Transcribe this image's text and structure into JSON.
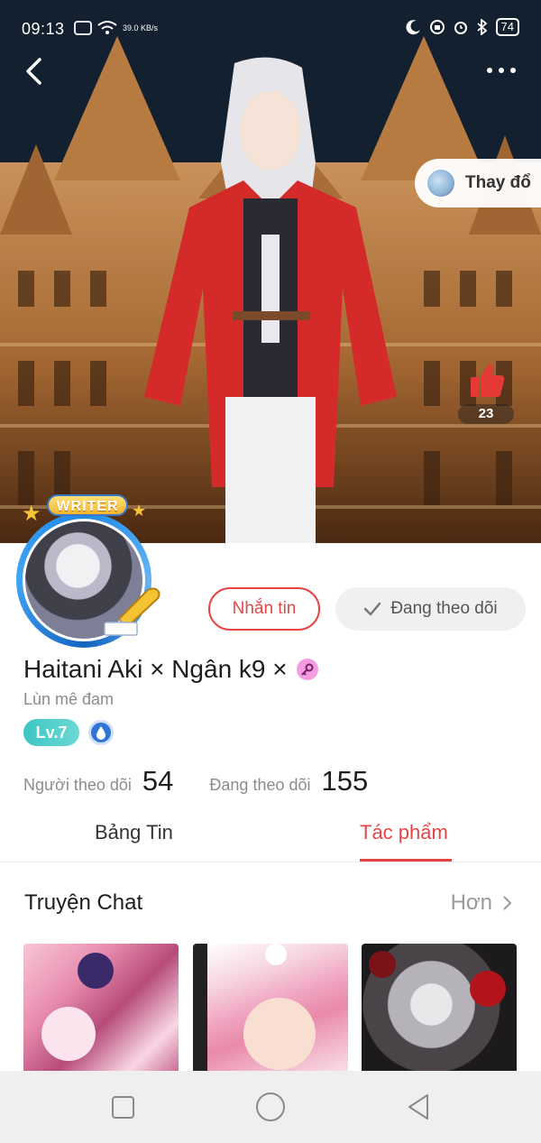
{
  "status_bar": {
    "time": "09:13",
    "net_speed": "39.0\nKB/s",
    "battery": "74"
  },
  "header": {
    "back_icon": "chevron-left-icon",
    "more_icon": "more-horizontal-icon",
    "change_outfit_label": "Thay đổ",
    "like_count": "23"
  },
  "profile": {
    "writer_badge": "WRITER",
    "message_button": "Nhắn tin",
    "following_button": "Đang theo dõi",
    "username": "Haitani Aki × Ngân k9 ×",
    "bio": "Lùn mê đam",
    "level": "Lv.7",
    "followers_label": "Người theo dõi",
    "followers_count": "54",
    "following_label": "Đang theo dõi",
    "following_count": "155"
  },
  "tabs": [
    {
      "label": "Bảng Tin",
      "active": false
    },
    {
      "label": "Tác phẩm",
      "active": true
    }
  ],
  "section": {
    "title": "Truyện Chat",
    "more_label": "Hơn"
  },
  "colors": {
    "accent": "#e64545",
    "level_badge": "#3ec5c5",
    "link_blue": "#2d74d6"
  }
}
